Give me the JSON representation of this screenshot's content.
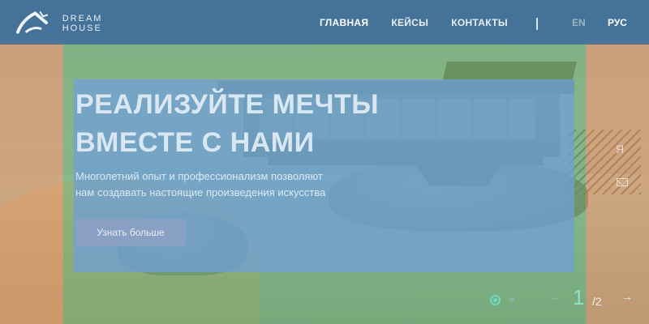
{
  "brand": {
    "logo_text": "DREAM HOUSE"
  },
  "nav": {
    "items": [
      {
        "label": "ГЛАВНАЯ",
        "active": true
      },
      {
        "label": "КЕЙСЫ",
        "active": false
      },
      {
        "label": "КОНТАКТЫ",
        "active": false
      }
    ]
  },
  "lang": {
    "en": "EN",
    "ru": "РУС"
  },
  "hero": {
    "title_line1": "РЕАЛИЗУЙТЕ МЕЧТЫ",
    "title_line2": "ВМЕСТЕ С НАМИ",
    "subtitle_line1": "Многолетний опыт и профессионализм позволяют",
    "subtitle_line2": "нам создавать настоящие произведения искусства",
    "button_label": "Узнать больше"
  },
  "side_icons": {
    "yandex": "Я",
    "mail_icon": "mail-icon"
  },
  "slider": {
    "current": "1",
    "total": "/2",
    "prev_arrow": "←",
    "next_arrow": "→"
  },
  "colors": {
    "header_bg": "#346696",
    "overlay_orange": "#f6a260",
    "overlay_green": "#84be6e",
    "overlay_blue": "#6f9edc",
    "accent": "#6fd6c4"
  }
}
